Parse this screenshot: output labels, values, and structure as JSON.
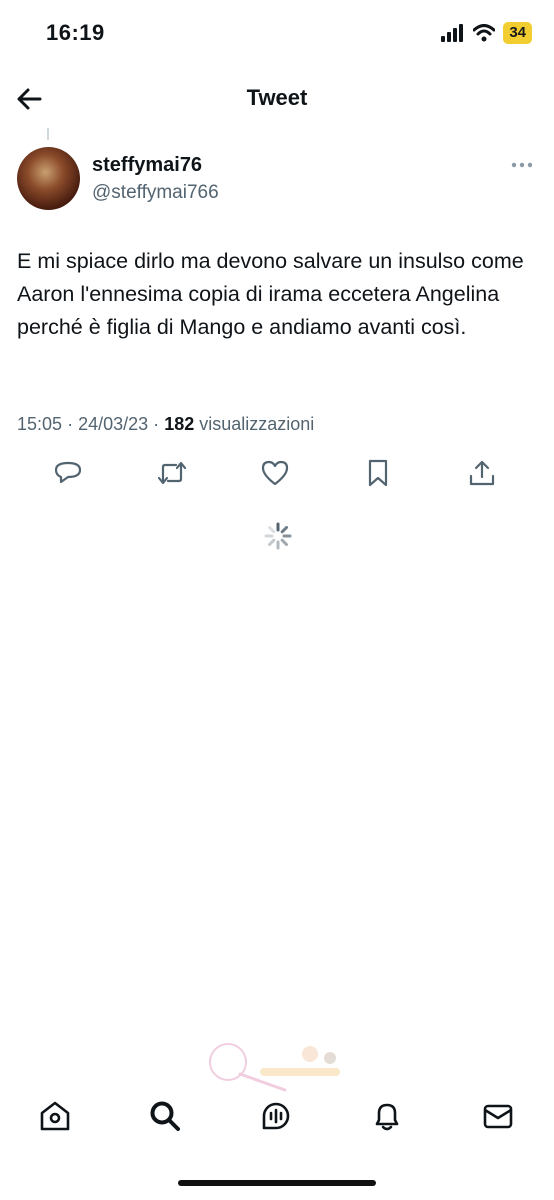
{
  "status_bar": {
    "time": "16:19",
    "battery": "34",
    "icons": [
      "signal-icon",
      "wifi-icon",
      "battery-icon"
    ]
  },
  "header": {
    "title": "Tweet",
    "back_icon": "back-arrow-icon"
  },
  "tweet": {
    "author": {
      "display_name": "steffymai76",
      "handle": "@steffymai766"
    },
    "text": "E mi spiace dirlo ma devono salvare un insulso come Aaron l'ennesima copia di irama eccetera Angelina perché è figlia di Mango e andiamo avanti così.",
    "time": "15:05",
    "date": "24/03/23",
    "views_count": "182",
    "views_label": "visualizzazioni",
    "separator": "·"
  },
  "actions": [
    "reply-icon",
    "retweet-icon",
    "like-icon",
    "bookmark-icon",
    "share-icon"
  ],
  "tab_bar": [
    "home-icon",
    "search-icon",
    "spaces-icon",
    "notifications-icon",
    "messages-icon"
  ],
  "colors": {
    "text": "#0f1419",
    "secondary": "#536471",
    "battery": "#f2cd30"
  }
}
